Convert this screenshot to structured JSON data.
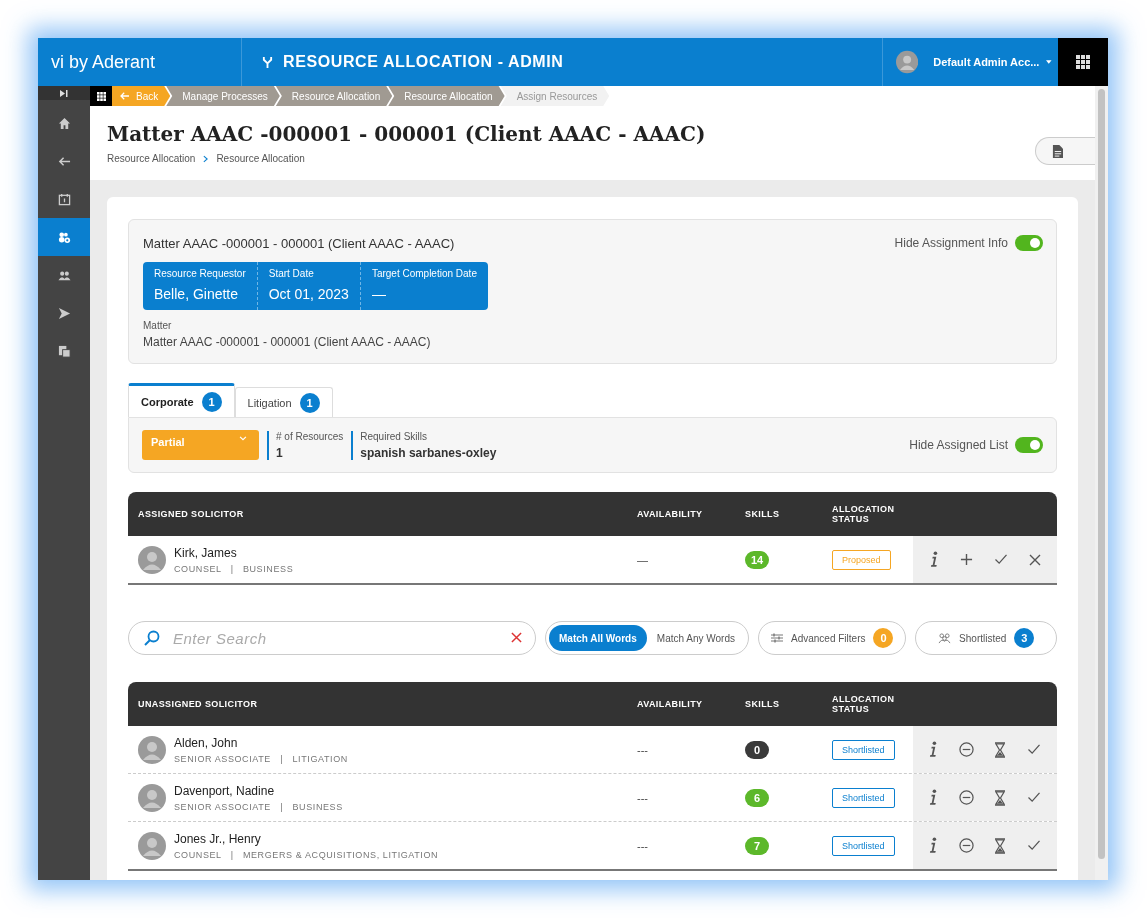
{
  "topbar": {
    "brand": "vi by Aderant",
    "title": "RESOURCE ALLOCATION - ADMIN",
    "user": "Default Admin Acc..."
  },
  "sidebar": {
    "items": [
      {
        "kind": "home",
        "selected": false
      },
      {
        "kind": "back",
        "selected": false
      },
      {
        "kind": "calendar",
        "selected": false
      },
      {
        "kind": "resources",
        "selected": true
      },
      {
        "kind": "people",
        "selected": false
      },
      {
        "kind": "send",
        "selected": false
      },
      {
        "kind": "documents",
        "selected": false
      }
    ]
  },
  "breadcrumb": [
    {
      "label": "Back",
      "kind": "back"
    },
    {
      "label": "Manage Processes",
      "kind": "step"
    },
    {
      "label": "Resource Allocation",
      "kind": "step"
    },
    {
      "label": "Resource Allocation",
      "kind": "step"
    },
    {
      "label": "Assign Resources",
      "kind": "current"
    }
  ],
  "page": {
    "title": "Matter AAAC -000001 - 000001 (Client AAAC - AAAC)",
    "path": [
      "Resource Allocation",
      "Resource Allocation"
    ]
  },
  "assignment": {
    "title": "Matter AAAC -000001 - 000001 (Client AAAC - AAAC)",
    "toggle": {
      "label": "Hide Assignment Info",
      "on": true
    },
    "fields": [
      {
        "label": "Resource Requestor",
        "value": "Belle, Ginette"
      },
      {
        "label": "Start Date",
        "value": "Oct 01, 2023"
      },
      {
        "label": "Target Completion Date",
        "value": "—"
      }
    ],
    "matter_label": "Matter",
    "matter_value": "Matter AAAC -000001 - 000001 (Client AAAC - AAAC)"
  },
  "tabs": [
    {
      "label": "Corporate",
      "count": "1",
      "selected": true
    },
    {
      "label": "Litigation",
      "count": "1",
      "selected": false
    }
  ],
  "requirement": {
    "status": "Partial",
    "resources_label": "# of Resources",
    "resources_value": "1",
    "skills_label": "Required Skills",
    "skills_value": "spanish sarbanes-oxley",
    "toggle": {
      "label": "Hide Assigned List",
      "on": true
    }
  },
  "assigned_table": {
    "columns": [
      "ASSIGNED SOLICITOR",
      "AVAILABILITY",
      "SKILLS",
      "ALLOCATION STATUS"
    ],
    "actions": [
      {
        "kind": "info"
      },
      {
        "kind": "add"
      },
      {
        "kind": "check"
      },
      {
        "kind": "close"
      }
    ],
    "rows": [
      {
        "name": "Kirk, James",
        "role": "COUNSEL   |   BUSINESS",
        "availability": "—",
        "skills": "14",
        "color": "#5cb82a",
        "status": {
          "label": "Proposed",
          "kind": "proposed"
        }
      }
    ]
  },
  "search": {
    "placeholder": "Enter Search",
    "match": [
      {
        "label": "Match All Words",
        "selected": true
      },
      {
        "label": "Match Any Words",
        "selected": false
      }
    ],
    "filters": {
      "label": "Advanced Filters",
      "count": "0"
    },
    "shortlisted": {
      "label": "Shortlisted",
      "count": "3"
    }
  },
  "unassigned_table": {
    "columns": [
      "UNASSIGNED SOLICITOR",
      "AVAILABILITY",
      "SKILLS",
      "ALLOCATION STATUS"
    ],
    "actions": [
      {
        "kind": "info"
      },
      {
        "kind": "remove"
      },
      {
        "kind": "hourglass"
      },
      {
        "kind": "check"
      }
    ],
    "rows": [
      {
        "name": "Alden, John",
        "role": "SENIOR ASSOCIATE   |   LITIGATION",
        "availability": "---",
        "skills": "0",
        "color": "#3a3a3a",
        "status": {
          "label": "Shortlisted",
          "kind": "shortlisted"
        }
      },
      {
        "name": "Davenport, Nadine",
        "role": "SENIOR ASSOCIATE   |   BUSINESS",
        "availability": "---",
        "skills": "6",
        "color": "#5cb82a",
        "status": {
          "label": "Shortlisted",
          "kind": "shortlisted"
        }
      },
      {
        "name": "Jones Jr., Henry",
        "role": "COUNSEL   |   MERGERS & ACQUISITIONS, LITIGATION",
        "availability": "---",
        "skills": "7",
        "color": "#5cb82a",
        "status": {
          "label": "Shortlisted",
          "kind": "shortlisted"
        }
      }
    ]
  }
}
